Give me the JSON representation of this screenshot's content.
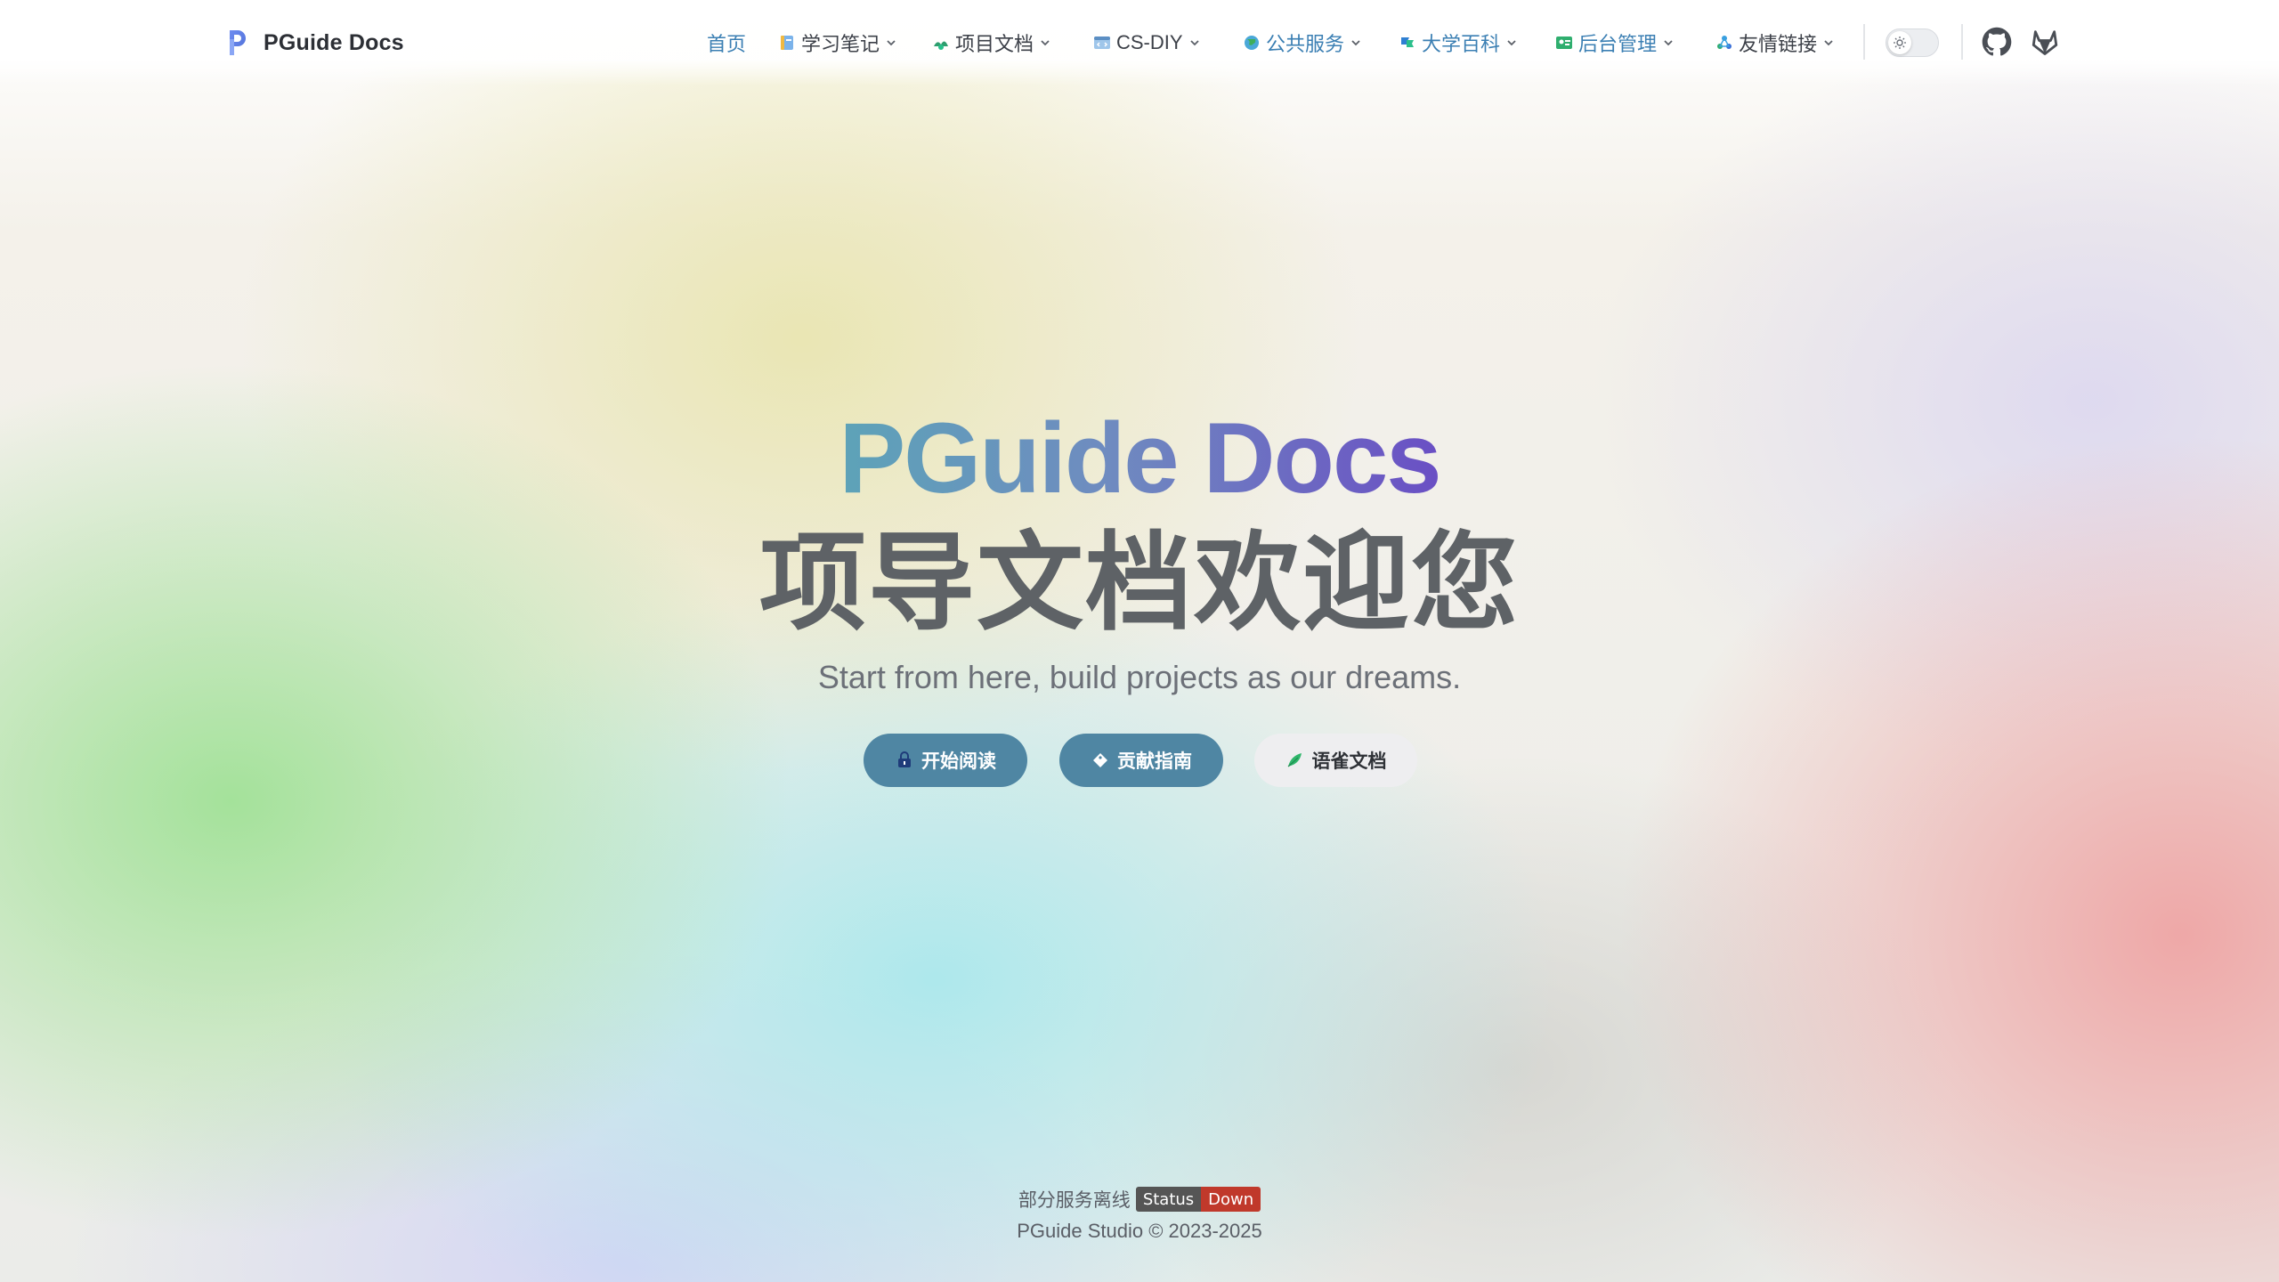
{
  "navbar": {
    "brand": "PGuide Docs",
    "items": [
      {
        "label": "首页",
        "icon": "home",
        "has_dropdown": false
      },
      {
        "label": "学习笔记",
        "icon": "notebook-icon",
        "has_dropdown": true
      },
      {
        "label": "项目文档",
        "icon": "project-icon",
        "has_dropdown": true
      },
      {
        "label": "CS-DIY",
        "icon": "code-window-icon",
        "has_dropdown": true
      },
      {
        "label": "公共服务",
        "icon": "globe-icon",
        "has_dropdown": true
      },
      {
        "label": "大学百科",
        "icon": "flag-icon",
        "has_dropdown": true
      },
      {
        "label": "后台管理",
        "icon": "admin-card-icon",
        "has_dropdown": true
      },
      {
        "label": "友情链接",
        "icon": "share-icon",
        "has_dropdown": true
      }
    ],
    "theme_toggle": "light",
    "social": [
      "github-icon",
      "gitlab-icon"
    ]
  },
  "hero": {
    "title": "PGuide Docs",
    "subtitle": "项导文档欢迎您",
    "tagline": "Start from here, build projects as our dreams.",
    "actions": [
      {
        "label": "开始阅读",
        "icon": "lock-open-icon",
        "theme": "brand"
      },
      {
        "label": "贡献指南",
        "icon": "diamond-tag-icon",
        "theme": "brand"
      },
      {
        "label": "语雀文档",
        "icon": "yuque-leaf-icon",
        "theme": "alt"
      }
    ]
  },
  "footer": {
    "status_text": "部分服务离线",
    "badge_label": "Status",
    "badge_value": "Down",
    "copyright": "PGuide Studio © 2023-2025"
  },
  "colors": {
    "brand_link": "#3b7fb3",
    "button_brand": "#4f86a3",
    "title_gradient": [
      "#5da3b8",
      "#6a4fc4"
    ],
    "badge_down": "#c0392b"
  }
}
